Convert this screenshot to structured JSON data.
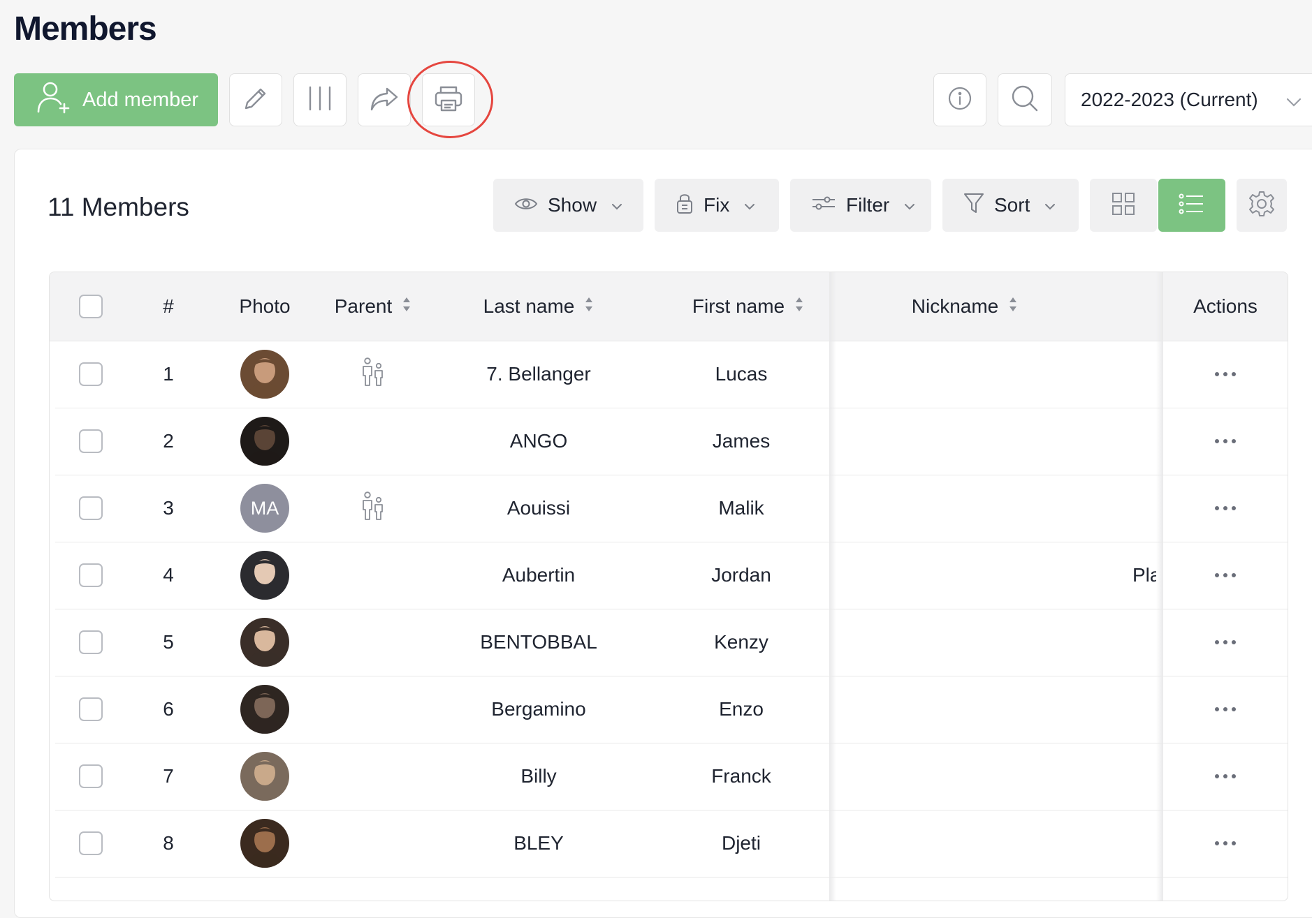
{
  "page": {
    "title": "Members"
  },
  "toolbar": {
    "add_member_label": "Add member",
    "season_value": "2022-2023 (Current)"
  },
  "panel": {
    "members_count": "11 Members",
    "controls": {
      "show": "Show",
      "fix": "Fix",
      "filter": "Filter",
      "sort": "Sort"
    }
  },
  "table": {
    "headers": {
      "number": "#",
      "photo": "Photo",
      "parent": "Parent",
      "last_name": "Last name",
      "first_name": "First name",
      "nickname": "Nickname",
      "actions": "Actions"
    },
    "rows": [
      {
        "number": "1",
        "last_name": "7. Bellanger",
        "first_name": "Lucas",
        "parent": true,
        "nickname": "",
        "avatar": "photo"
      },
      {
        "number": "2",
        "last_name": "ANGO",
        "first_name": "James",
        "parent": false,
        "nickname": "",
        "avatar": "photo"
      },
      {
        "number": "3",
        "last_name": "Aouissi",
        "first_name": "Malik",
        "parent": true,
        "nickname": "",
        "avatar": "initials",
        "initials": "MA"
      },
      {
        "number": "4",
        "last_name": "Aubertin",
        "first_name": "Jordan",
        "parent": false,
        "nickname": "Pla",
        "avatar": "photo"
      },
      {
        "number": "5",
        "last_name": "BENTOBBAL",
        "first_name": "Kenzy",
        "parent": false,
        "nickname": "",
        "avatar": "photo"
      },
      {
        "number": "6",
        "last_name": "Bergamino",
        "first_name": "Enzo",
        "parent": false,
        "nickname": "",
        "avatar": "photo"
      },
      {
        "number": "7",
        "last_name": "Billy",
        "first_name": "Franck",
        "parent": false,
        "nickname": "",
        "avatar": "photo"
      },
      {
        "number": "8",
        "last_name": "BLEY",
        "first_name": "Djeti",
        "parent": false,
        "nickname": "",
        "avatar": "photo"
      }
    ]
  },
  "colors": {
    "accent_green": "#7cc382",
    "highlight_ring": "#e5463f",
    "title_text": "#10172e"
  },
  "icons": {
    "add_member": "user-plus-icon",
    "edit": "pencil-icon",
    "columns": "columns-icon",
    "share": "share-arrow-icon",
    "print": "printer-icon",
    "info": "info-icon",
    "search": "search-icon",
    "show": "eye-icon",
    "fix": "lock-icon",
    "filter": "sliders-icon",
    "sort": "funnel-icon",
    "grid_view": "grid-icon",
    "list_view": "list-icon",
    "settings": "gear-icon",
    "parent": "parent-child-icon",
    "actions": "more-dots-icon"
  }
}
